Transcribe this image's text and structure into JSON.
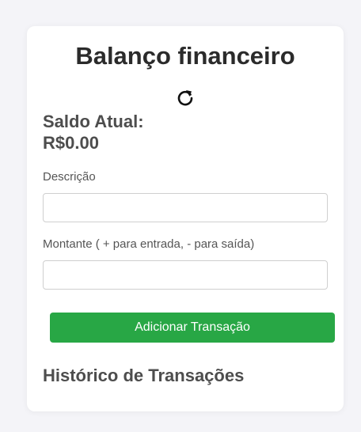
{
  "app": {
    "title": "Balanço financeiro",
    "refresh_icon": "refresh-icon"
  },
  "balance": {
    "label": "Saldo Atual:",
    "value": "R$0.00"
  },
  "form": {
    "description": {
      "label": "Descrição",
      "value": "",
      "placeholder": ""
    },
    "amount": {
      "label": "Montante ( + para entrada, - para saída)",
      "value": "",
      "placeholder": ""
    },
    "submit_label": "Adicionar Transação"
  },
  "history": {
    "title": "Histórico de Transações",
    "items": []
  },
  "colors": {
    "accent": "#28a745",
    "background": "#f4f4f8",
    "card": "#ffffff",
    "text": "#2b2b2b"
  }
}
